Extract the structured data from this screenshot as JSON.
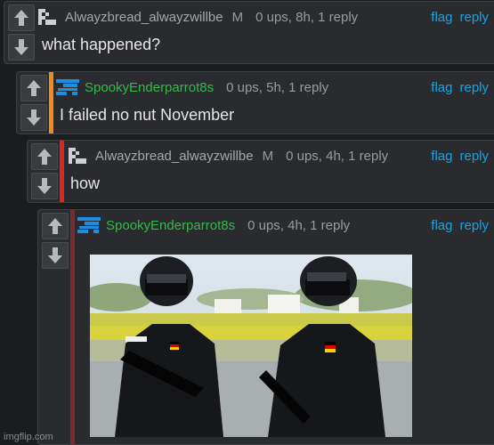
{
  "comments": [
    {
      "username": "Alwayzbread_alwayzwillbe",
      "badge": "M",
      "meta": "0 ups, 8h, 1 reply",
      "text": "what happened?",
      "avatar": "pixel-figure-icon",
      "stripe_color": ""
    },
    {
      "username": "SpookyEnderparrot8s",
      "meta": "0 ups, 5h, 1 reply",
      "text": "I failed no nut November",
      "avatar": "blue-glitch-icon",
      "stripe_color": "#f08c1a"
    },
    {
      "username": "Alwayzbread_alwayzwillbe",
      "badge": "M",
      "meta": "0 ups, 4h, 1 reply",
      "text": "how",
      "avatar": "pixel-figure-icon",
      "stripe_color": "#e02424"
    },
    {
      "username": "SpookyEnderparrot8s",
      "meta": "0 ups, 4h, 1 reply",
      "image": "two-armed-police-officers-photo",
      "avatar": "blue-glitch-icon",
      "stripe_color": "#7a2a30"
    }
  ],
  "actions": {
    "flag": "flag",
    "reply": "reply"
  },
  "watermark": "imgflip.com",
  "colors": {
    "link": "#1aa3e0",
    "green_user": "#33b849",
    "background": "#1b1c1e"
  }
}
